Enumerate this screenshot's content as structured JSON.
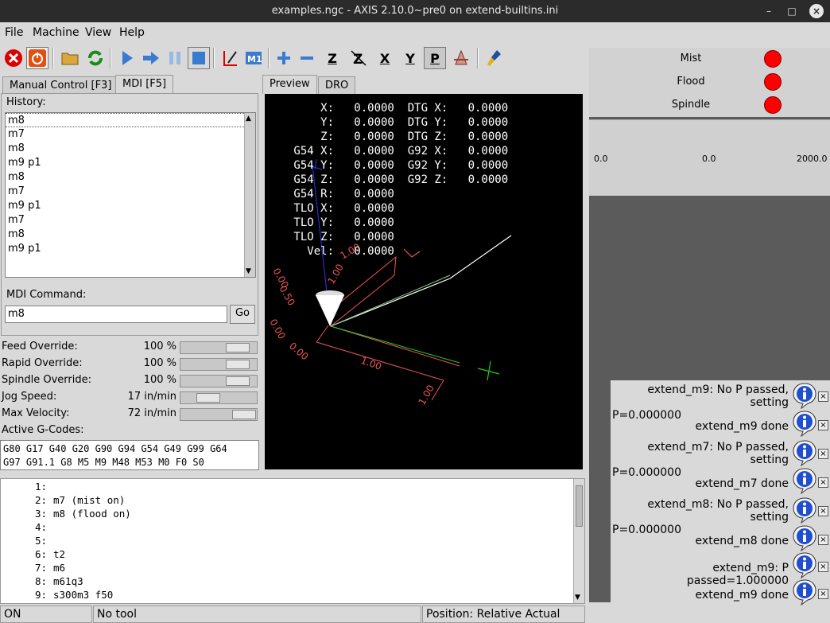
{
  "window": {
    "title": "examples.ngc - AXIS 2.10.0~pre0 on extend-builtins.ini"
  },
  "menu": {
    "file": "File",
    "machine": "Machine",
    "view": "View",
    "help": "Help"
  },
  "tabs": {
    "manual": "Manual Control [F3]",
    "mdi": "MDI [F5]",
    "preview": "Preview",
    "dro": "DRO"
  },
  "mdi": {
    "history_label": "History:",
    "history": [
      "m8",
      "m7",
      "m8",
      "m9 p1",
      "m8",
      "m7",
      "m9 p1",
      "m7",
      "m8",
      "m9 p1"
    ],
    "command_label": "MDI Command:",
    "command_value": "m8",
    "go_label": "Go"
  },
  "overrides": [
    {
      "label": "Feed Override:",
      "value": "100 %",
      "level": 1.0
    },
    {
      "label": "Rapid Override:",
      "value": "100 %",
      "level": 1.0
    },
    {
      "label": "Spindle Override:",
      "value": "100 %",
      "level": 1.0
    },
    {
      "label": "Jog Speed:",
      "value": "17 in/min",
      "level": 0.3
    },
    {
      "label": "Max Velocity:",
      "value": "72 in/min",
      "level": 1.0
    }
  ],
  "gcodes": {
    "label": "Active G-Codes:",
    "line1": "G80 G17 G40 G20 G90 G94 G54 G49 G99 G64",
    "line2": "G97 G91.1 G8 M5 M9 M48 M53 M0 F0 S0"
  },
  "dro": {
    "lines": [
      "     X:   0.0000  DTG X:   0.0000",
      "     Y:   0.0000  DTG Y:   0.0000",
      "     Z:   0.0000  DTG Z:   0.0000",
      " G54 X:   0.0000  G92 X:   0.0000",
      " G54 Y:   0.0000  G92 Y:   0.0000",
      " G54 Z:   0.0000  G92 Z:   0.0000",
      " G54 R:   0.0000",
      " TLO X:   0.0000",
      " TLO Y:   0.0000",
      " TLO Z:   0.0000",
      "   Vel:   0.0000"
    ],
    "axis_labels": {
      "a": "1.00",
      "b": "0.00",
      "c": "0.50",
      "d": "0.00",
      "e": "0.00",
      "f": "1.00",
      "g": "1.00",
      "h": "1.00"
    }
  },
  "code": [
    {
      "n": "1:",
      "t": ""
    },
    {
      "n": "2:",
      "t": "m7 (mist on)"
    },
    {
      "n": "3:",
      "t": "m8 (flood on)"
    },
    {
      "n": "4:",
      "t": ""
    },
    {
      "n": "5:",
      "t": ""
    },
    {
      "n": "6:",
      "t": "t2"
    },
    {
      "n": "7:",
      "t": "m6"
    },
    {
      "n": "8:",
      "t": "m61q3"
    },
    {
      "n": "9:",
      "t": "s300m3 f50"
    }
  ],
  "status": {
    "state": "ON",
    "tool": "No tool",
    "position": "Position: Relative Actual"
  },
  "hal": {
    "leds": [
      {
        "label": "Mist",
        "color": "#ff0000"
      },
      {
        "label": "Flood",
        "color": "#ff0000"
      },
      {
        "label": "Spindle",
        "color": "#ff0000"
      }
    ],
    "bar": {
      "min": "0.0",
      "value": "0.0",
      "max": "2000.0"
    }
  },
  "notifications": [
    {
      "text1": "extend_m9:  No P passed, setting",
      "text2": "P=0.000000"
    },
    {
      "text1": "extend_m9 done",
      "text2": ""
    },
    {
      "text1": "extend_m7:  No P passed, setting",
      "text2": "P=0.000000"
    },
    {
      "text1": "extend_m7 done",
      "text2": ""
    },
    {
      "text1": "extend_m8:  No P passed, setting",
      "text2": "P=0.000000"
    },
    {
      "text1": "extend_m8 done",
      "text2": ""
    },
    {
      "text1": "extend_m9:  P passed=1.000000",
      "text2": ""
    },
    {
      "text1": "extend_m9 done",
      "text2": ""
    }
  ],
  "icons": [
    "estop-icon",
    "power-icon",
    "open-icon",
    "reload-icon",
    "run-icon",
    "step-icon",
    "pause-icon",
    "stop-icon",
    "blockdelete-icon",
    "optionalstop-icon",
    "zoom-in-icon",
    "zoom-out-icon",
    "view-z-icon",
    "view-z2-icon",
    "view-x-icon",
    "view-y-icon",
    "view-p-icon",
    "rotate-icon",
    "clear-plot-icon",
    "info-icon"
  ]
}
